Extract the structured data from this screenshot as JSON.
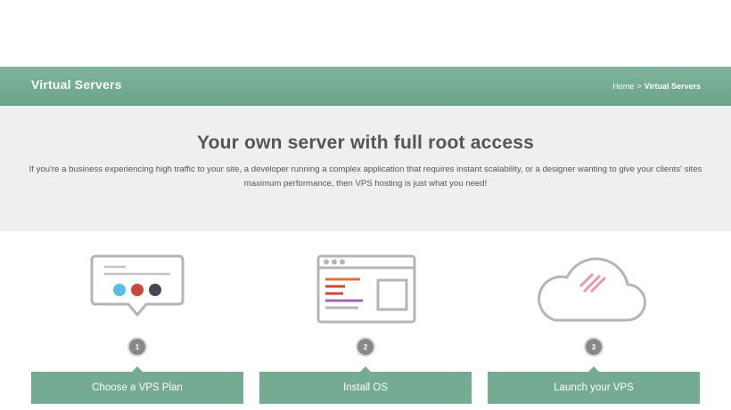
{
  "header": {
    "title": "Virtual Servers",
    "breadcrumb": {
      "home": "Home",
      "separator": ">",
      "current": "Virtual Servers"
    }
  },
  "hero": {
    "title": "Your own server with full root access",
    "text": "If you're a business experiencing high traffic to your site, a developer running a complex application that requires instant scalability, or a designer wanting to give your clients' sites maximum performance, then VPS hosting is just what you need!"
  },
  "steps": [
    {
      "number": "1",
      "label": "Choose a VPS Plan",
      "icon": "chat-bubble-icon"
    },
    {
      "number": "2",
      "label": "Install OS",
      "icon": "browser-window-icon"
    },
    {
      "number": "3",
      "label": "Launch your VPS",
      "icon": "cloud-icon"
    }
  ],
  "colors": {
    "accent": "#74ab92",
    "badge": "#888888",
    "hero_bg": "#efefef",
    "icon_stroke": "#b5b5b5",
    "dot_blue": "#5bbde4",
    "dot_red": "#c8483a",
    "dot_dark": "#4a4452",
    "line_orange": "#e0703a",
    "line_red": "#c8483a",
    "line_purple": "#9b6bb5",
    "stripe_pink": "#e59aa6"
  }
}
